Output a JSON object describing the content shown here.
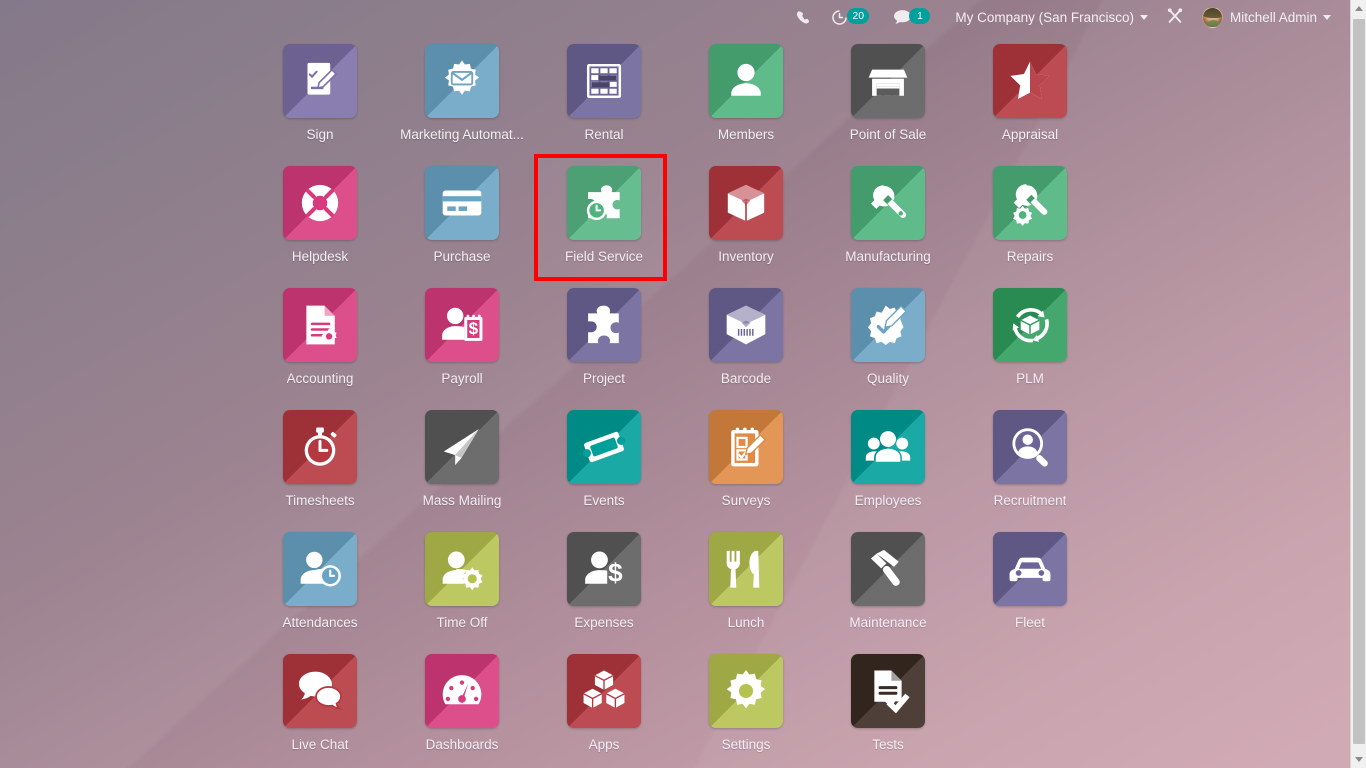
{
  "topbar": {
    "phone_icon": "phone-icon",
    "activities": {
      "icon": "clock-activity-icon",
      "count": "20"
    },
    "messages": {
      "icon": "chat-bubble-icon",
      "count": "1"
    },
    "company": {
      "label": "My Company (San Francisco)",
      "caret": "chevron-down-icon"
    },
    "debug": {
      "icon": "developer-tools-icon"
    },
    "user": {
      "name": "Mitchell Admin",
      "avatar": "user-avatar",
      "caret": "chevron-down-icon"
    }
  },
  "colors": {
    "badge": "#00a09d",
    "selection": "#ff0000",
    "label": "#f3eef2"
  },
  "scrollbar": {
    "up_arrow": "scroll-up-arrow",
    "down_arrow": "scroll-down-arrow"
  },
  "apps": [
    {
      "name": "Sign",
      "icon": "sign-document-icon",
      "color": "#7d6fa8",
      "selected": false
    },
    {
      "name": "Marketing Automat...",
      "icon": "gear-envelope-icon",
      "color": "#6aa4c4",
      "selected": false
    },
    {
      "name": "Rental",
      "icon": "rental-calendar-icon",
      "color": "#6d6497",
      "selected": false
    },
    {
      "name": "Members",
      "icon": "person-icon",
      "color": "#4eb37d",
      "selected": false
    },
    {
      "name": "Point of Sale",
      "icon": "shop-icon",
      "color": "#5c5c5c",
      "selected": false
    },
    {
      "name": "Appraisal",
      "icon": "half-star-icon",
      "color": "#b4383f",
      "selected": false
    },
    {
      "name": "Helpdesk",
      "icon": "life-ring-icon",
      "color": "#d83b7d",
      "selected": false
    },
    {
      "name": "Purchase",
      "icon": "credit-card-icon",
      "color": "#6aa4c4",
      "selected": false
    },
    {
      "name": "Field Service",
      "icon": "puzzle-timer-icon",
      "color": "#4eb37d",
      "selected": true
    },
    {
      "name": "Inventory",
      "icon": "open-box-icon",
      "color": "#b4383f",
      "selected": false
    },
    {
      "name": "Manufacturing",
      "icon": "wrench-icon",
      "color": "#4eb37d",
      "selected": false
    },
    {
      "name": "Repairs",
      "icon": "wrench-gear-icon",
      "color": "#4eb37d",
      "selected": false
    },
    {
      "name": "Accounting",
      "icon": "invoice-gear-icon",
      "color": "#d83b7d",
      "selected": false
    },
    {
      "name": "Payroll",
      "icon": "person-payslip-icon",
      "color": "#d83b7d",
      "selected": false
    },
    {
      "name": "Project",
      "icon": "puzzle-icon",
      "color": "#6d6497",
      "selected": false
    },
    {
      "name": "Barcode",
      "icon": "barcode-box-icon",
      "color": "#6d6497",
      "selected": false
    },
    {
      "name": "Quality",
      "icon": "badge-pencil-icon",
      "color": "#6aa4c4",
      "selected": false
    },
    {
      "name": "PLM",
      "icon": "lifecycle-cube-icon",
      "color": "#2f9e5e",
      "selected": false
    },
    {
      "name": "Timesheets",
      "icon": "stopwatch-icon",
      "color": "#b4383f",
      "selected": false
    },
    {
      "name": "Mass Mailing",
      "icon": "paper-plane-icon",
      "color": "#5c5c5c",
      "selected": false
    },
    {
      "name": "Events",
      "icon": "ticket-icon",
      "color": "#009f9a",
      "selected": false
    },
    {
      "name": "Surveys",
      "icon": "clipboard-pencil-icon",
      "color": "#e08a43",
      "selected": false
    },
    {
      "name": "Employees",
      "icon": "people-group-icon",
      "color": "#009f9a",
      "selected": false
    },
    {
      "name": "Recruitment",
      "icon": "person-search-icon",
      "color": "#6d6497",
      "selected": false
    },
    {
      "name": "Attendances",
      "icon": "person-clock-icon",
      "color": "#6aa4c4",
      "selected": false
    },
    {
      "name": "Time Off",
      "icon": "person-sun-icon",
      "color": "#b5c24f",
      "selected": false
    },
    {
      "name": "Expenses",
      "icon": "person-dollar-icon",
      "color": "#5c5c5c",
      "selected": false
    },
    {
      "name": "Lunch",
      "icon": "fork-knife-icon",
      "color": "#b5c24f",
      "selected": false
    },
    {
      "name": "Maintenance",
      "icon": "hammer-icon",
      "color": "#5c5c5c",
      "selected": false
    },
    {
      "name": "Fleet",
      "icon": "car-icon",
      "color": "#6d6497",
      "selected": false
    },
    {
      "name": "Live Chat",
      "icon": "speech-bubbles-icon",
      "color": "#b4383f",
      "selected": false
    },
    {
      "name": "Dashboards",
      "icon": "gauge-icon",
      "color": "#d83b7d",
      "selected": false
    },
    {
      "name": "Apps",
      "icon": "cubes-icon",
      "color": "#b4383f",
      "selected": false
    },
    {
      "name": "Settings",
      "icon": "gear-icon",
      "color": "#b5c24f",
      "selected": false
    },
    {
      "name": "Tests",
      "icon": "document-check-icon",
      "color": "#3a2a22",
      "selected": false
    }
  ]
}
